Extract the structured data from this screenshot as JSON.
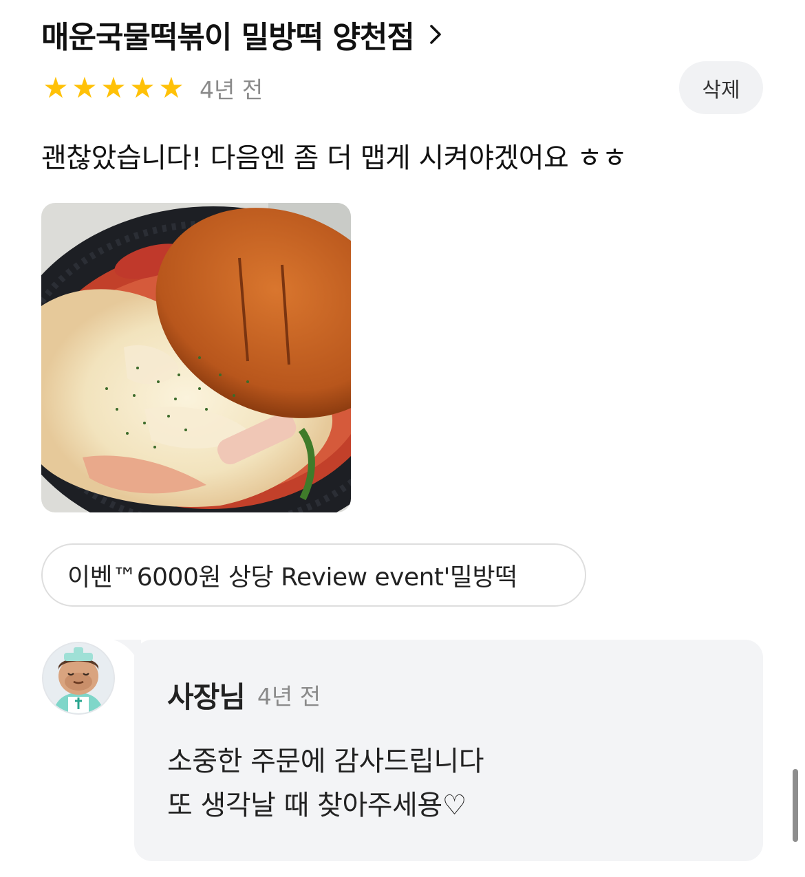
{
  "review": {
    "store_name": "매운국물떡볶이 밀방떡 양천점",
    "rating": 5,
    "rating_max": 5,
    "date": "4년 전",
    "delete_label": "삭제",
    "text": "괜찮았습니다! 다음엔 좀 더 맵게 시켜야겠어요 ㅎㅎ",
    "menu_item": "이벤™6000원 상당 Review event'밀방떡"
  },
  "reply": {
    "author": "사장님",
    "date": "4년 전",
    "lines": [
      "소중한 주문에 감사드립니다",
      "또 생각날 때 찾아주세용♡"
    ]
  },
  "colors": {
    "star": "#ffc107",
    "secondary_text": "#8a8a8a",
    "reply_bg": "#f3f4f6"
  }
}
